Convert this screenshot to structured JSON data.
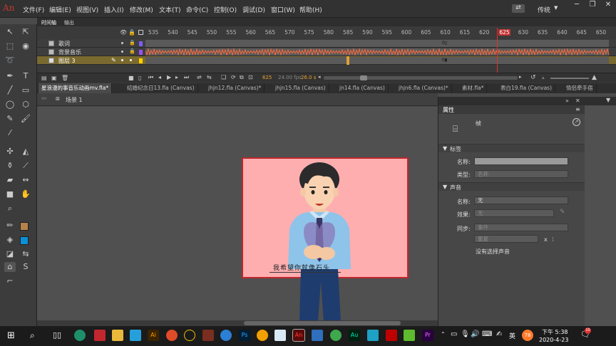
{
  "app": {
    "logo": "An",
    "workspace": "传统",
    "workspace_icon": "sync-icon"
  },
  "menu": [
    "文件(F)",
    "编辑(E)",
    "视图(V)",
    "插入(I)",
    "修改(M)",
    "文本(T)",
    "命令(C)",
    "控制(O)",
    "调试(D)",
    "窗口(W)",
    "帮助(H)"
  ],
  "timeline": {
    "tabs": [
      "时间轴",
      "输出"
    ],
    "ticks": [
      "535",
      "540",
      "545",
      "550",
      "555",
      "560",
      "565",
      "570",
      "575",
      "580",
      "585",
      "590",
      "595",
      "600",
      "605",
      "610",
      "615",
      "620",
      "625",
      "630",
      "635",
      "640",
      "645",
      "650"
    ],
    "layers": [
      {
        "name": "歌词",
        "color": "#7a5cff"
      },
      {
        "name": "背景音乐",
        "color": "#9b4dff"
      },
      {
        "name": "图层 3",
        "color": "#ffd000"
      }
    ],
    "current_frame": "625",
    "fps": "24.00 fps",
    "time": "26.0 s"
  },
  "doc_tabs": [
    "星浪漫的事音乐动画mv.fla*",
    "结婚纪念日13.fla (Canvas)",
    "jhjn12.fla (Canvas)*",
    "jhjn15.fla (Canvas)",
    "jn14.fla (Canvas)",
    "jhjn6.fla (Canvas)*",
    "素材.fla*",
    "表白19.fla (Canvas)",
    "情侣牵手宿"
  ],
  "scene": {
    "label": "场景 1"
  },
  "stage": {
    "lyric": "我希望你就像石头"
  },
  "properties": {
    "title": "属性",
    "frame_label": "帧",
    "label_section": "标签",
    "name_label": "名称:",
    "type_label": "类型:",
    "type_value": "名称",
    "sound_section": "声音",
    "sound_name_label": "名称:",
    "sound_name_value": "无",
    "effect_label": "效果:",
    "effect_value": "无",
    "sync_label": "同步:",
    "sync_value": "事件",
    "repeat_value": "重复",
    "repeat_x": "x",
    "repeat_count": "1",
    "no_sound": "没有选择声音"
  },
  "taskbar": {
    "ime": "英",
    "time": "下午 5:38",
    "date": "2020-4-23",
    "badge": "78",
    "notifications": "10"
  }
}
